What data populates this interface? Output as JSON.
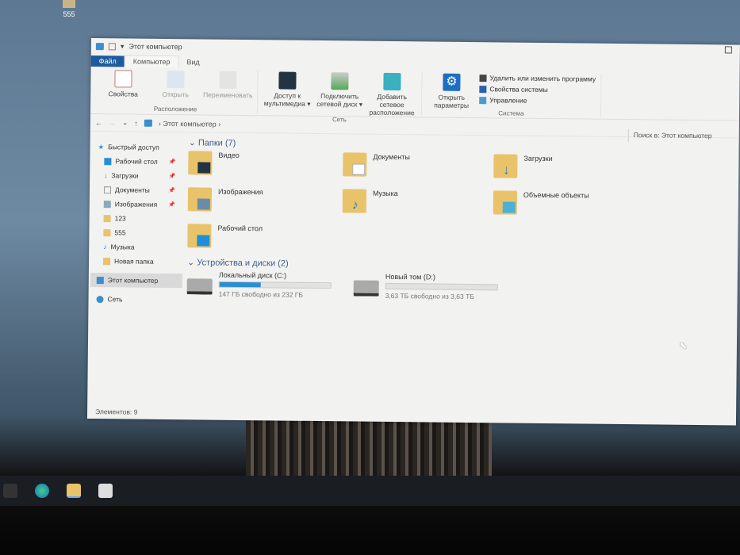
{
  "desktop": {
    "icon_label": "555"
  },
  "window": {
    "title": "Этот компьютер"
  },
  "tabs": [
    "Файл",
    "Компьютер",
    "Вид"
  ],
  "ribbon": {
    "location": {
      "label": "Расположение",
      "buttons": [
        "Свойства",
        "Открыть",
        "Переименовать"
      ]
    },
    "network": {
      "label": "Сеть",
      "buttons": [
        "Доступ к мультимедиа ▾",
        "Подключить сетевой диск ▾",
        "Добавить сетевое расположение"
      ]
    },
    "system": {
      "label": "Система",
      "open_settings": "Открыть параметры",
      "links": [
        "Удалить или изменить программу",
        "Свойства системы",
        "Управление"
      ]
    }
  },
  "address": {
    "path": "Этот компьютер",
    "search_placeholder": "Поиск в: Этот компьютер"
  },
  "nav": {
    "quick_access": "Быстрый доступ",
    "items": [
      "Рабочий стол",
      "Загрузки",
      "Документы",
      "Изображения",
      "123",
      "555",
      "Музыка",
      "Новая папка"
    ],
    "this_pc": "Этот компьютер",
    "network": "Сеть"
  },
  "folders": {
    "header": "Папки (7)",
    "items": [
      "Видео",
      "Документы",
      "Загрузки",
      "Изображения",
      "Музыка",
      "Объемные объекты",
      "Рабочий стол"
    ]
  },
  "drives": {
    "header": "Устройства и диски (2)",
    "items": [
      {
        "name": "Локальный диск (C:)",
        "free": "147 ГБ свободно из 232 ГБ",
        "used_fraction": 0.37
      },
      {
        "name": "Новый том (D:)",
        "free": "3,63 ТБ свободно из 3,63 ТБ",
        "used_fraction": 0.0
      }
    ]
  },
  "status": "Элементов: 9"
}
